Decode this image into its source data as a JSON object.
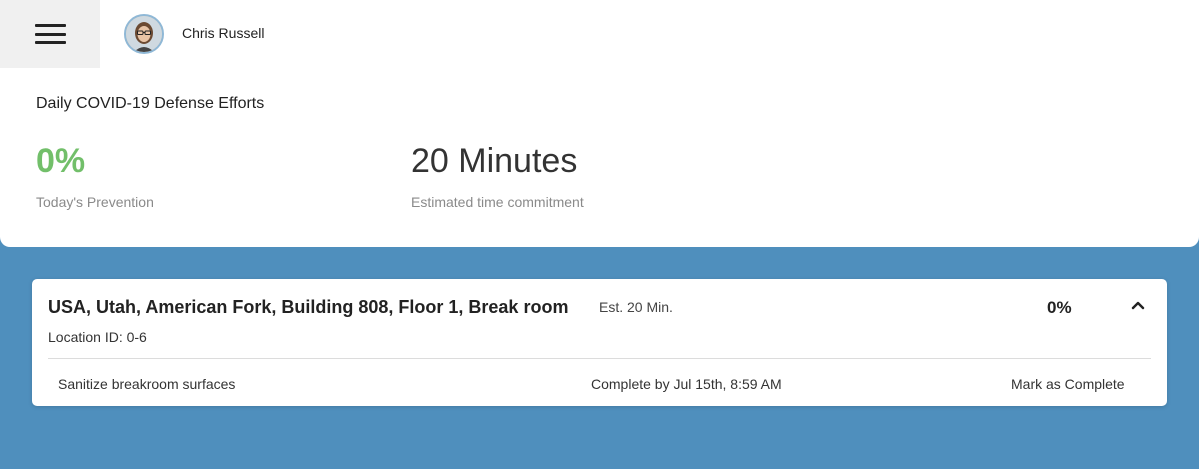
{
  "header": {
    "menu_icon": "hamburger-icon",
    "user": {
      "name": "Chris Russell",
      "avatar": "avatar"
    }
  },
  "summary": {
    "title": "Daily COVID-19 Defense Efforts",
    "prevention": {
      "value": "0%",
      "label": "Today's Prevention",
      "color": "#72bf6a"
    },
    "time": {
      "value": "20 Minutes",
      "label": "Estimated time commitment"
    }
  },
  "location": {
    "name": "USA, Utah, American Fork, Building 808, Floor 1, Break room",
    "estimate": "Est. 20 Min.",
    "percent": "0%",
    "location_id": "Location ID: 0-6",
    "collapse_icon": "chevron-up-icon",
    "tasks": [
      {
        "name": "Sanitize breakroom surfaces",
        "due": "Complete by Jul 15th, 8:59 AM",
        "action": "Mark as Complete"
      }
    ]
  },
  "colors": {
    "background": "#4f8fbd",
    "panel": "#ffffff",
    "accent_green": "#72bf6a"
  }
}
